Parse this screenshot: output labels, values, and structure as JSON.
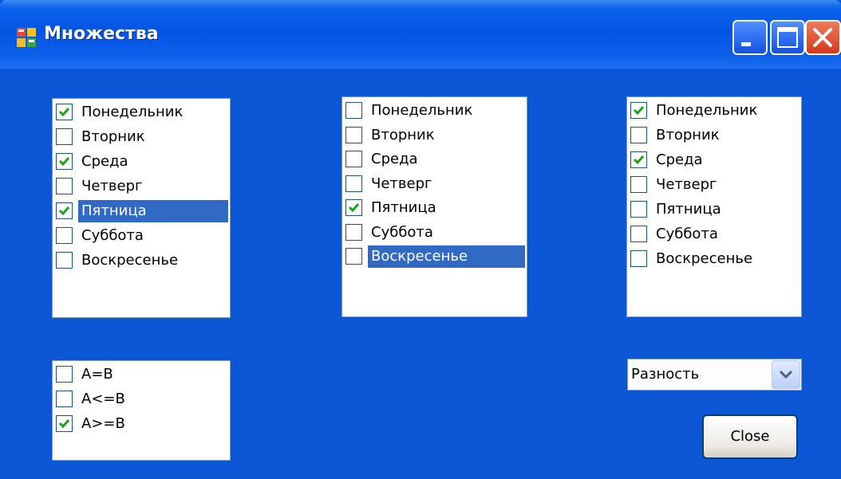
{
  "window": {
    "title": "Множества"
  },
  "list_a": {
    "items": [
      {
        "label": "Понедельник",
        "checked": true,
        "selected": false
      },
      {
        "label": "Вторник",
        "checked": false,
        "selected": false
      },
      {
        "label": "Среда",
        "checked": true,
        "selected": false
      },
      {
        "label": "Четверг",
        "checked": false,
        "selected": false
      },
      {
        "label": "Пятница",
        "checked": true,
        "selected": true
      },
      {
        "label": "Суббота",
        "checked": false,
        "selected": false
      },
      {
        "label": "Воскресенье",
        "checked": false,
        "selected": false
      }
    ]
  },
  "list_b": {
    "items": [
      {
        "label": "Понедельник",
        "checked": false,
        "selected": false
      },
      {
        "label": "Вторник",
        "checked": false,
        "selected": false
      },
      {
        "label": "Среда",
        "checked": false,
        "selected": false
      },
      {
        "label": "Четверг",
        "checked": false,
        "selected": false
      },
      {
        "label": "Пятница",
        "checked": true,
        "selected": false
      },
      {
        "label": "Суббота",
        "checked": false,
        "selected": false
      },
      {
        "label": "Воскресенье",
        "checked": false,
        "selected": true
      }
    ]
  },
  "list_result": {
    "items": [
      {
        "label": "Понедельник",
        "checked": true,
        "selected": false
      },
      {
        "label": "Вторник",
        "checked": false,
        "selected": false
      },
      {
        "label": "Среда",
        "checked": true,
        "selected": false
      },
      {
        "label": "Четверг",
        "checked": false,
        "selected": false
      },
      {
        "label": "Пятница",
        "checked": false,
        "selected": false
      },
      {
        "label": "Суббота",
        "checked": false,
        "selected": false
      },
      {
        "label": "Воскресенье",
        "checked": false,
        "selected": false
      }
    ]
  },
  "compare": {
    "items": [
      {
        "label": "A=B",
        "checked": false,
        "selected": false
      },
      {
        "label": "A<=B",
        "checked": false,
        "selected": false
      },
      {
        "label": "A>=B",
        "checked": true,
        "selected": false
      }
    ]
  },
  "operation": {
    "selected": "Разность"
  },
  "close_label": "Close"
}
